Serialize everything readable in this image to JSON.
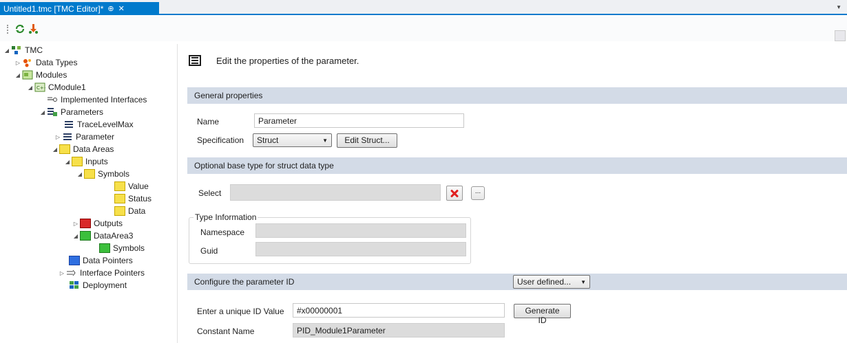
{
  "tab": {
    "title": "Untitled1.tmc [TMC Editor]*",
    "pin": "⊕",
    "close": "✕"
  },
  "tree": {
    "nodes": [
      {
        "label": "TMC"
      },
      {
        "label": "Data Types"
      },
      {
        "label": "Modules"
      },
      {
        "label": "CModule1"
      },
      {
        "label": "Implemented Interfaces"
      },
      {
        "label": "Parameters"
      },
      {
        "label": "TraceLevelMax"
      },
      {
        "label": "Parameter"
      },
      {
        "label": "Data Areas"
      },
      {
        "label": "Inputs"
      },
      {
        "label": "Symbols"
      },
      {
        "label": "Value"
      },
      {
        "label": "Status"
      },
      {
        "label": "Data"
      },
      {
        "label": "Outputs"
      },
      {
        "label": "DataArea3"
      },
      {
        "label": "Symbols"
      },
      {
        "label": "Data Pointers"
      },
      {
        "label": "Interface Pointers"
      },
      {
        "label": "Deployment"
      }
    ]
  },
  "panel": {
    "header": "Edit the properties of the parameter.",
    "general": {
      "title": "General properties",
      "name_label": "Name",
      "name_value": "Parameter",
      "spec_label": "Specification",
      "spec_value": "Struct",
      "edit_struct": "Edit Struct..."
    },
    "basetype": {
      "title": "Optional base type for struct data type",
      "select_label": "Select",
      "dots": "...",
      "type_info": "Type Information",
      "namespace_label": "Namespace",
      "guid_label": "Guid"
    },
    "paramid": {
      "title": "Configure the parameter ID",
      "mode": "User defined...",
      "id_label": "Enter a unique ID Value",
      "id_value": "#x00000001",
      "generate": "Generate ID",
      "const_label": "Constant Name",
      "const_value": "PID_Module1Parameter"
    }
  }
}
